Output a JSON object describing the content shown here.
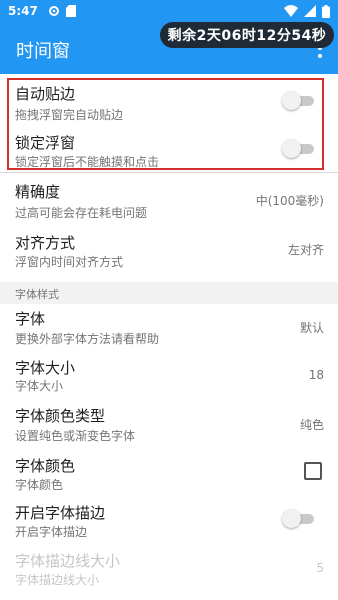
{
  "status_bar": {
    "time": "5:47"
  },
  "app": {
    "title": "时间窗",
    "floating_timer": "剩余2天06时12分54秒"
  },
  "settings": [
    {
      "title": "自动贴边",
      "summary": "拖拽浮窗完自动贴边",
      "control": "toggle",
      "on": false
    },
    {
      "title": "锁定浮窗",
      "summary": "锁定浮窗后不能触摸和点击",
      "control": "toggle",
      "on": false
    },
    {
      "title": "精确度",
      "summary": "过高可能会存在耗电问题",
      "value": "中(100毫秒)"
    },
    {
      "title": "对齐方式",
      "summary": "浮窗内时间对齐方式",
      "value": "左对齐"
    }
  ],
  "font_section": {
    "header": "字体样式",
    "items": [
      {
        "title": "字体",
        "summary": "更换外部字体方法请看帮助",
        "value": "默认"
      },
      {
        "title": "字体大小",
        "summary": "字体大小",
        "value": "18"
      },
      {
        "title": "字体颜色类型",
        "summary": "设置纯色或渐变色字体",
        "value": "纯色"
      },
      {
        "title": "字体颜色",
        "summary": "字体颜色",
        "control": "checkbox",
        "checked": false
      },
      {
        "title": "开启字体描边",
        "summary": "开启字体描边",
        "control": "toggle",
        "on": false
      },
      {
        "title": "字体描边线大小",
        "summary": "字体描边线大小",
        "value": "5",
        "disabled": true
      }
    ]
  }
}
